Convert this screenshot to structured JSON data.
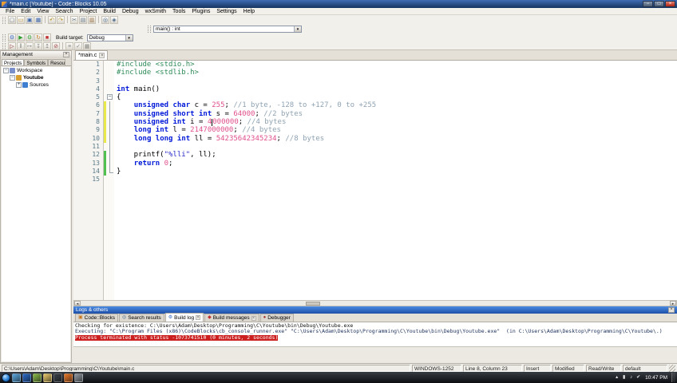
{
  "window": {
    "title": "*main.c [Youtube] - Code::Blocks 10.05",
    "controls": {
      "min": "−",
      "max": "□",
      "close": "×"
    }
  },
  "ui": {
    "close_glyph": "×",
    "dropdown_arrow": "▾",
    "scroll_left": "◂",
    "scroll_right": "▸",
    "minus": "−",
    "plus": "+"
  },
  "menu": {
    "items": [
      "File",
      "Edit",
      "View",
      "Search",
      "Project",
      "Build",
      "Debug",
      "wxSmith",
      "Tools",
      "Plugins",
      "Settings",
      "Help"
    ]
  },
  "toolbar": {
    "file_icons": [
      {
        "name": "new-file-icon",
        "glyph": "▢",
        "color": "#667788"
      },
      {
        "name": "open-file-icon",
        "glyph": "▭",
        "color": "#c89a30"
      },
      {
        "name": "save-icon",
        "glyph": "▣",
        "color": "#3a62a8"
      },
      {
        "name": "save-all-icon",
        "glyph": "▦",
        "color": "#3a62a8"
      },
      {
        "sep": true
      },
      {
        "name": "undo-icon",
        "glyph": "↶",
        "color": "#b89020"
      },
      {
        "name": "redo-icon",
        "glyph": "↷",
        "color": "#b89020"
      },
      {
        "sep": true
      },
      {
        "name": "cut-icon",
        "glyph": "✂",
        "color": "#667788"
      },
      {
        "name": "copy-icon",
        "glyph": "▤",
        "color": "#667788"
      },
      {
        "name": "paste-icon",
        "glyph": "▥",
        "color": "#9a7040"
      },
      {
        "sep": true
      },
      {
        "name": "find-icon",
        "glyph": "◎",
        "color": "#446688"
      },
      {
        "name": "replace-icon",
        "glyph": "◈",
        "color": "#446688"
      }
    ],
    "symbol_combo": "main() : int",
    "build_icons": [
      {
        "name": "build-icon",
        "glyph": "⚙",
        "color": "#3a6ac0"
      },
      {
        "name": "run-icon",
        "glyph": "▶",
        "color": "#2f9e2f"
      },
      {
        "name": "build-and-run-icon",
        "glyph": "⚙",
        "color": "#2f9e2f"
      },
      {
        "name": "rebuild-icon",
        "glyph": "↻",
        "color": "#c07820"
      },
      {
        "name": "abort-icon",
        "glyph": "■",
        "color": "#c03030"
      }
    ],
    "build_target": {
      "label": "Build target:",
      "value": "Debug"
    },
    "misc_icons": [
      {
        "name": "debug-run-icon",
        "glyph": "▷",
        "color": "#883030"
      },
      {
        "name": "debug-pause-icon",
        "glyph": "‖",
        "color": "#888880"
      },
      {
        "name": "step-over-icon",
        "glyph": "↦",
        "color": "#888880"
      },
      {
        "name": "step-into-icon",
        "glyph": "↧",
        "color": "#888880"
      },
      {
        "name": "step-out-icon",
        "glyph": "↥",
        "color": "#888880"
      },
      {
        "name": "stop-debugger-icon",
        "glyph": "⊘",
        "color": "#a04040"
      },
      {
        "sep": true
      },
      {
        "name": "debug-windows-icon",
        "glyph": "≡",
        "color": "#888880"
      },
      {
        "name": "info-windows-icon",
        "glyph": "✓",
        "color": "#888880"
      },
      {
        "name": "misc-toolbar-icon",
        "glyph": "▦",
        "color": "#888880"
      }
    ]
  },
  "management": {
    "title": "Management",
    "tabs": [
      {
        "label": "Projects",
        "active": true
      },
      {
        "label": "Symbols",
        "active": false
      },
      {
        "label": "Resources",
        "active": false,
        "clip": true
      }
    ],
    "tree": [
      {
        "label": "Workspace",
        "depth": 0,
        "expander": "−",
        "icon_color": "#7a90cc",
        "bold": false
      },
      {
        "label": "Youtube",
        "depth": 1,
        "expander": "−",
        "icon_color": "#d8a030",
        "bold": true
      },
      {
        "label": "Sources",
        "depth": 2,
        "expander": "+",
        "icon_color": "#3f7fd0",
        "bold": false
      }
    ]
  },
  "editor": {
    "tab": {
      "label": "*main.c",
      "close": "×"
    },
    "lines": [
      {
        "n": 1,
        "fold": "",
        "marker": "",
        "seg": [
          {
            "t": "pp",
            "s": "#include <stdio.h>"
          }
        ]
      },
      {
        "n": 2,
        "fold": "",
        "marker": "",
        "seg": [
          {
            "t": "pp",
            "s": "#include <stdlib.h>"
          }
        ]
      },
      {
        "n": 3,
        "fold": "",
        "marker": "",
        "seg": []
      },
      {
        "n": 4,
        "fold": "",
        "marker": "",
        "seg": [
          {
            "t": "kw",
            "s": "int"
          },
          {
            "t": "txt",
            "s": " main()"
          }
        ]
      },
      {
        "n": 5,
        "fold": "start",
        "marker": "",
        "seg": [
          {
            "t": "txt",
            "s": "{"
          }
        ]
      },
      {
        "n": 6,
        "fold": "mid",
        "marker": "yellow",
        "seg": [
          {
            "t": "txt",
            "s": "    "
          },
          {
            "t": "kw",
            "s": "unsigned"
          },
          {
            "t": "txt",
            "s": " "
          },
          {
            "t": "kw",
            "s": "char"
          },
          {
            "t": "txt",
            "s": " c = "
          },
          {
            "t": "num",
            "s": "255"
          },
          {
            "t": "txt",
            "s": "; "
          },
          {
            "t": "com",
            "s": "//1 byte, -128 to +127, 0 to +255"
          }
        ]
      },
      {
        "n": 7,
        "fold": "mid",
        "marker": "yellow",
        "seg": [
          {
            "t": "txt",
            "s": "    "
          },
          {
            "t": "kw",
            "s": "unsigned"
          },
          {
            "t": "txt",
            "s": " "
          },
          {
            "t": "kw",
            "s": "short"
          },
          {
            "t": "txt",
            "s": " "
          },
          {
            "t": "kw",
            "s": "int"
          },
          {
            "t": "txt",
            "s": " s = "
          },
          {
            "t": "num",
            "s": "64000"
          },
          {
            "t": "txt",
            "s": "; "
          },
          {
            "t": "com",
            "s": "//2 bytes"
          }
        ]
      },
      {
        "n": 8,
        "fold": "mid",
        "marker": "yellow",
        "seg": [
          {
            "t": "txt",
            "s": "    "
          },
          {
            "t": "kw",
            "s": "unsigned"
          },
          {
            "t": "txt",
            "s": " "
          },
          {
            "t": "kw",
            "s": "int"
          },
          {
            "t": "txt",
            "s": " i = "
          },
          {
            "t": "num",
            "s": "4"
          },
          {
            "t": "caret",
            "s": ""
          },
          {
            "t": "num",
            "s": "000000"
          },
          {
            "t": "txt",
            "s": "; "
          },
          {
            "t": "com",
            "s": "//4 bytes"
          }
        ]
      },
      {
        "n": 9,
        "fold": "mid",
        "marker": "yellow",
        "seg": [
          {
            "t": "txt",
            "s": "    "
          },
          {
            "t": "kw",
            "s": "long"
          },
          {
            "t": "txt",
            "s": " "
          },
          {
            "t": "kw",
            "s": "int"
          },
          {
            "t": "txt",
            "s": " l = "
          },
          {
            "t": "num",
            "s": "2147000000"
          },
          {
            "t": "txt",
            "s": "; "
          },
          {
            "t": "com",
            "s": "//4 bytes"
          }
        ]
      },
      {
        "n": 10,
        "fold": "mid",
        "marker": "yellow",
        "seg": [
          {
            "t": "txt",
            "s": "    "
          },
          {
            "t": "kw",
            "s": "long"
          },
          {
            "t": "txt",
            "s": " "
          },
          {
            "t": "kw",
            "s": "long"
          },
          {
            "t": "txt",
            "s": " "
          },
          {
            "t": "kw",
            "s": "int"
          },
          {
            "t": "txt",
            "s": " ll = "
          },
          {
            "t": "num",
            "s": "54235642345234"
          },
          {
            "t": "txt",
            "s": "; "
          },
          {
            "t": "com",
            "s": "//8 bytes"
          }
        ]
      },
      {
        "n": 11,
        "fold": "mid",
        "marker": "",
        "seg": []
      },
      {
        "n": 12,
        "fold": "mid",
        "marker": "green",
        "seg": [
          {
            "t": "txt",
            "s": "    printf("
          },
          {
            "t": "str",
            "s": "\"%lli\""
          },
          {
            "t": "txt",
            "s": ", ll);"
          }
        ]
      },
      {
        "n": 13,
        "fold": "mid",
        "marker": "green",
        "seg": [
          {
            "t": "txt",
            "s": "    "
          },
          {
            "t": "kw",
            "s": "return"
          },
          {
            "t": "txt",
            "s": " "
          },
          {
            "t": "num",
            "s": "0"
          },
          {
            "t": "txt",
            "s": ";"
          }
        ]
      },
      {
        "n": 14,
        "fold": "end",
        "marker": "green",
        "seg": [
          {
            "t": "txt",
            "s": "}"
          }
        ]
      },
      {
        "n": 15,
        "fold": "",
        "marker": "",
        "seg": []
      }
    ]
  },
  "logs": {
    "title": "Logs & others",
    "tabs": [
      {
        "label": "Code::Blocks",
        "icon_name": "codeblocks-log-icon",
        "glyph": "▣",
        "color": "#c87820",
        "active": false,
        "closable": false
      },
      {
        "label": "Search results",
        "icon_name": "search-results-icon",
        "glyph": "◎",
        "color": "#446688",
        "active": false,
        "closable": false
      },
      {
        "label": "Build log",
        "icon_name": "build-log-icon",
        "glyph": "⚙",
        "color": "#3a6ac0",
        "active": true,
        "closable": true
      },
      {
        "label": "Build messages",
        "icon_name": "build-messages-icon",
        "glyph": "◆",
        "color": "#c03030",
        "active": false,
        "closable": true
      },
      {
        "label": "Debugger",
        "icon_name": "debugger-icon",
        "glyph": "●",
        "color": "#a03030",
        "active": false,
        "closable": false
      }
    ],
    "lines": [
      {
        "style": "plain",
        "text": "Checking for existence: C:\\Users\\Adam\\Desktop\\Programming\\C\\Youtube\\bin\\Debug\\Youtube.exe"
      },
      {
        "style": "exec",
        "text": "Executing: \"C:\\Program Files (x86)\\CodeBlocks\\cb_console_runner.exe\" \"C:\\Users\\Adam\\Desktop\\Programming\\C\\Youtube\\bin\\Debug\\Youtube.exe\"  (in C:\\Users\\Adam\\Desktop\\Programming\\C\\Youtube\\.)"
      },
      {
        "style": "error",
        "text": "Process terminated with status -1073741510 (0 minutes, 2 seconds)"
      }
    ]
  },
  "statusbar": {
    "path": "C:\\Users\\Adam\\Desktop\\Programming\\C\\Youtube\\main.c",
    "encoding": "WINDOWS-1252",
    "position": "Line 8, Column 23",
    "insert_mode": "Insert",
    "modified": "Modified",
    "readwrite": "Read/Write",
    "profile": "default"
  },
  "taskbar": {
    "time": "10:47 PM",
    "apps": [
      {
        "color": "#5aa8e0"
      },
      {
        "color": "#2868c8"
      },
      {
        "color": "#88b848"
      },
      {
        "color": "#e8c868"
      },
      {
        "color": "#384048"
      },
      {
        "color": "#e87828"
      },
      {
        "color": "#9098a0"
      }
    ],
    "tray_icons": [
      {
        "name": "tray-customize-icon",
        "glyph": "▴"
      },
      {
        "name": "tray-network-icon",
        "glyph": "▮"
      },
      {
        "name": "tray-volume-icon",
        "glyph": "♪"
      },
      {
        "name": "tray-notification-icon",
        "glyph": "✔"
      }
    ]
  },
  "colors": {
    "titlebar": "#16345e",
    "logs_header": "#2f66c4",
    "error_bg": "#cc2020",
    "keyword": "#0018d8",
    "number": "#e0508c",
    "comment": "#8fa3b3",
    "string": "#2828c8",
    "preprocessor": "#2e8b57",
    "change_marker_modified": "#e8e84a",
    "change_marker_saved": "#50c050"
  }
}
